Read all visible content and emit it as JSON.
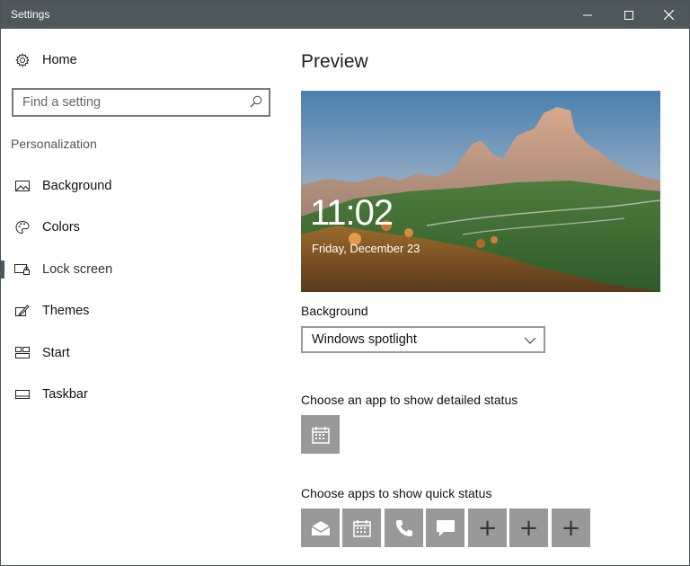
{
  "window": {
    "title": "Settings"
  },
  "sidebar": {
    "home_label": "Home",
    "search_placeholder": "Find a setting",
    "section_title": "Personalization",
    "items": [
      {
        "label": "Background",
        "icon": "picture-icon"
      },
      {
        "label": "Colors",
        "icon": "palette-icon"
      },
      {
        "label": "Lock screen",
        "icon": "lock-screen-icon",
        "selected": true
      },
      {
        "label": "Themes",
        "icon": "brush-icon"
      },
      {
        "label": "Start",
        "icon": "start-tiles-icon"
      },
      {
        "label": "Taskbar",
        "icon": "taskbar-icon"
      }
    ]
  },
  "main": {
    "title": "Preview",
    "preview": {
      "time": "11:02",
      "date": "Friday, December 23"
    },
    "background_label": "Background",
    "background_value": "Windows spotlight",
    "detailed_status_label": "Choose an app to show detailed status",
    "detailed_status_app": "calendar-icon",
    "quick_status_label": "Choose apps to show quick status",
    "quick_status_apps": [
      "mail-icon",
      "calendar-icon",
      "phone-icon",
      "message-icon",
      "plus-icon",
      "plus-icon",
      "plus-icon"
    ],
    "quick_plus": "+"
  },
  "colors": {
    "titlebar": "#4d575c",
    "tile": "#999999",
    "accent_bar": "#4d575c"
  }
}
